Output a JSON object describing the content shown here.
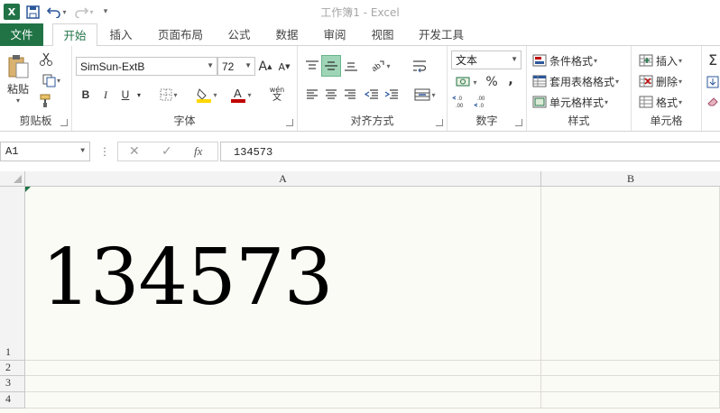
{
  "window": {
    "title": "工作簿1 - Excel"
  },
  "tabs": [
    "文件",
    "开始",
    "插入",
    "页面布局",
    "公式",
    "数据",
    "审阅",
    "视图",
    "开发工具"
  ],
  "ribbon": {
    "clipboard": {
      "label": "剪贴板",
      "paste": "粘贴"
    },
    "font": {
      "label": "字体",
      "name": "SimSun-ExtB",
      "size": "72",
      "bold": "B",
      "italic": "I",
      "underline": "U",
      "wen": "wén",
      "wen_char": "文"
    },
    "alignment": {
      "label": "对齐方式"
    },
    "number": {
      "label": "数字",
      "format": "文本",
      "percent": "%",
      "comma": ","
    },
    "styles": {
      "label": "样式",
      "conditional": "条件格式",
      "table": "套用表格格式",
      "cell": "单元格样式"
    },
    "cells": {
      "label": "单元格",
      "insert": "插入",
      "delete": "删除",
      "format": "格式"
    }
  },
  "formula_bar": {
    "name_box": "A1",
    "value": "134573",
    "fx": "fx",
    "cancel": "✕",
    "enter": "✓"
  },
  "sheet": {
    "columns": [
      "A",
      "B"
    ],
    "rows": [
      "1",
      "2",
      "3",
      "4"
    ],
    "a1_value": "134573"
  },
  "colors": {
    "brand": "#217346",
    "qat": "#2b579a"
  }
}
